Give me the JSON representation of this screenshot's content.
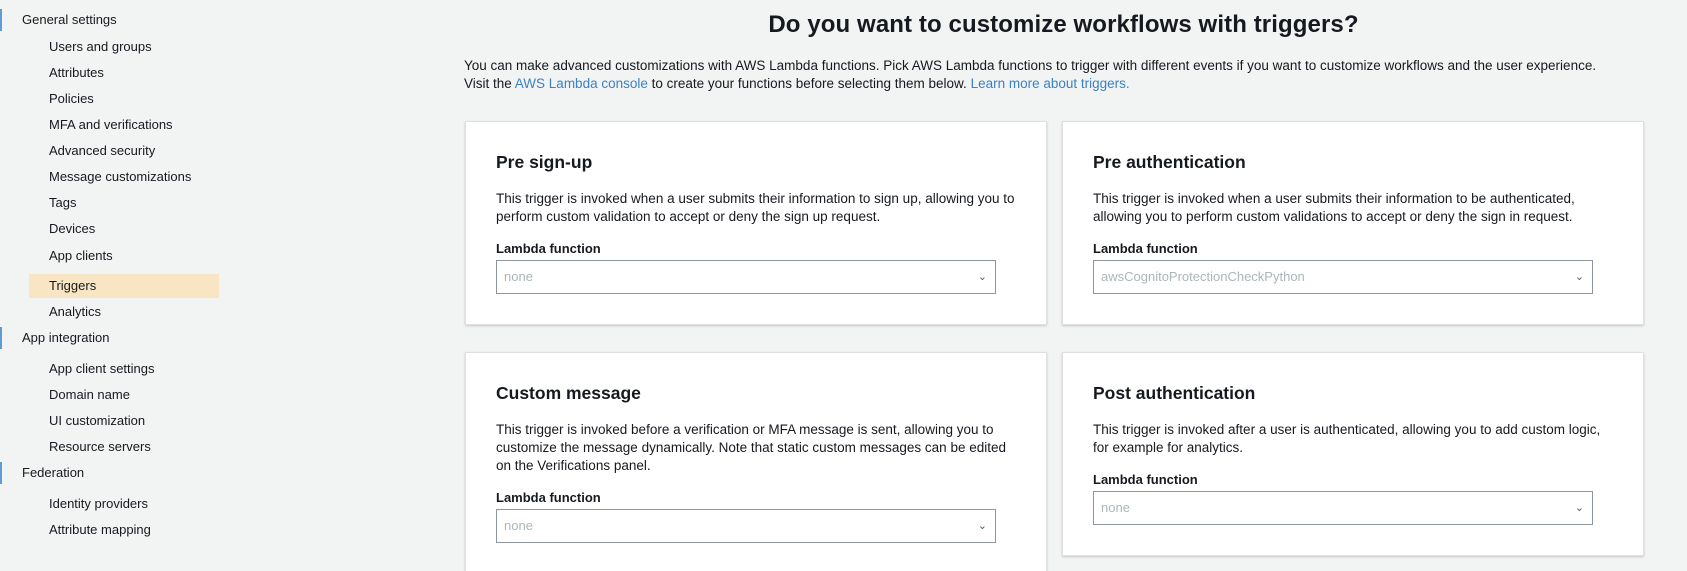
{
  "sidebar": {
    "general_settings": "General settings",
    "general_items": [
      {
        "label": "Users and groups"
      },
      {
        "label": "Attributes"
      },
      {
        "label": "Policies"
      },
      {
        "label": "MFA and verifications"
      },
      {
        "label": "Advanced security"
      },
      {
        "label": "Message customizations"
      },
      {
        "label": "Tags"
      },
      {
        "label": "Devices"
      },
      {
        "label": "App clients"
      },
      {
        "label": "Triggers",
        "active": true
      },
      {
        "label": "Analytics"
      }
    ],
    "app_integration": "App integration",
    "app_items": [
      {
        "label": "App client settings"
      },
      {
        "label": "Domain name"
      },
      {
        "label": "UI customization"
      },
      {
        "label": "Resource servers"
      }
    ],
    "federation": "Federation",
    "federation_items": [
      {
        "label": "Identity providers"
      },
      {
        "label": "Attribute mapping"
      }
    ]
  },
  "main": {
    "headline": "Do you want to customize workflows with triggers?",
    "intro_1": "You can make advanced customizations with AWS Lambda functions. Pick AWS Lambda functions to trigger with different events if you want to customize workflows and the user experience.",
    "intro_2_pre": "Visit the ",
    "intro_link_console": "AWS Lambda console",
    "intro_2_mid": " to create your functions before selecting them below. ",
    "intro_link_learn": "Learn more about triggers.",
    "lambda_label": "Lambda function",
    "cards": {
      "pre_signup": {
        "title": "Pre sign-up",
        "desc": "This trigger is invoked when a user submits their information to sign up, allowing you to perform custom validation to accept or deny the sign up request.",
        "value": "none"
      },
      "pre_auth": {
        "title": "Pre authentication",
        "desc": "This trigger is invoked when a user submits their information to be authenticated, allowing you to perform custom validations to accept or deny the sign in request.",
        "value": "awsCognitoProtectionCheckPython"
      },
      "custom_message": {
        "title": "Custom message",
        "desc": "This trigger is invoked before a verification or MFA message is sent, allowing you to customize the message dynamically. Note that static custom messages can be edited on the Verifications panel.",
        "value": "none"
      },
      "post_auth": {
        "title": "Post authentication",
        "desc": "This trigger is invoked after a user is authenticated, allowing you to add custom logic, for example for analytics.",
        "value": "none"
      }
    }
  },
  "colors": {
    "accent": "#3b82c4",
    "active_bg": "#f8e5c4",
    "section_marker": "#5f9bd5"
  }
}
